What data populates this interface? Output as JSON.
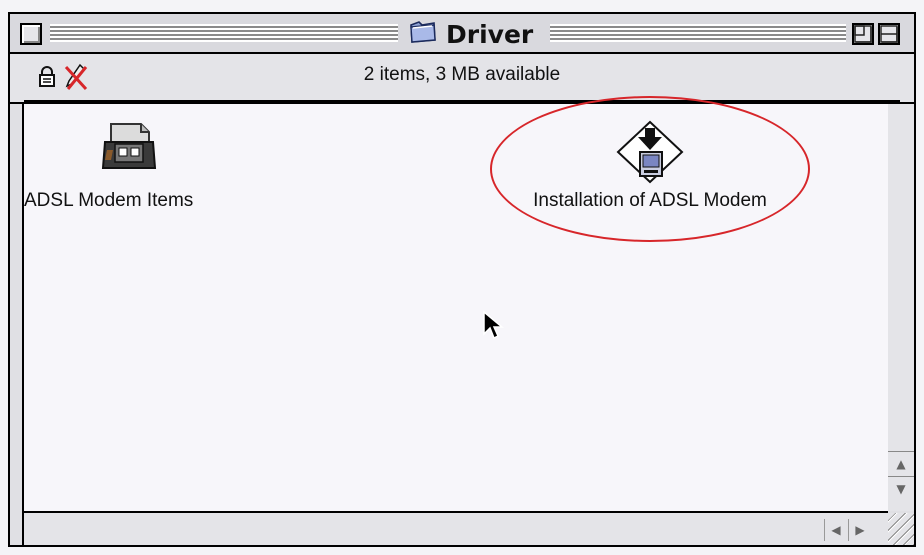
{
  "window": {
    "title": "Driver",
    "status": "2 items, 3 MB available"
  },
  "icons": [
    {
      "name": "ADSL Modem Items",
      "icon": "folder-package-icon"
    },
    {
      "name": "Installation of ADSL Modem",
      "icon": "installer-icon"
    }
  ],
  "annotation": {
    "color": "#d7262a",
    "target": "Installation of ADSL Modem"
  }
}
